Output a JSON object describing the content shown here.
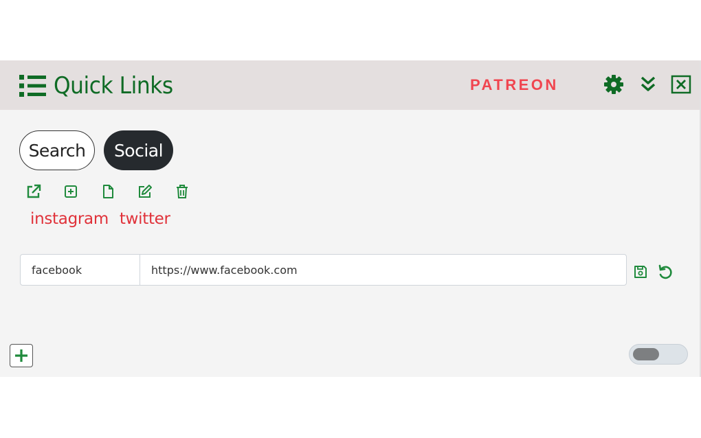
{
  "header": {
    "title": "Quick Links",
    "patreon_label": "PATREON"
  },
  "icons": {
    "list": "list-icon",
    "gear": "gear-icon",
    "collapse": "double-chevron-down-icon",
    "close": "close-box-icon",
    "open": "external-link-icon",
    "add_square": "plus-square-icon",
    "file": "file-icon",
    "edit": "edit-icon",
    "trash": "trash-icon",
    "save": "floppy-icon",
    "undo": "undo-icon",
    "plus": "plus-icon"
  },
  "tabs": [
    {
      "label": "Search",
      "active": false
    },
    {
      "label": "Social",
      "active": true
    }
  ],
  "links": [
    {
      "label": "instagram"
    },
    {
      "label": "twitter"
    }
  ],
  "editor": {
    "name_value": "facebook",
    "url_value": "https://www.facebook.com"
  },
  "toggle": {
    "on": false
  },
  "colors": {
    "brand_green": "#0f6b25",
    "action_green": "#1f8a3c",
    "link_red": "#e0323a",
    "patreon_red": "#f0454f",
    "header_bg": "#e4dfdf",
    "active_tab_bg": "#262a2e"
  }
}
